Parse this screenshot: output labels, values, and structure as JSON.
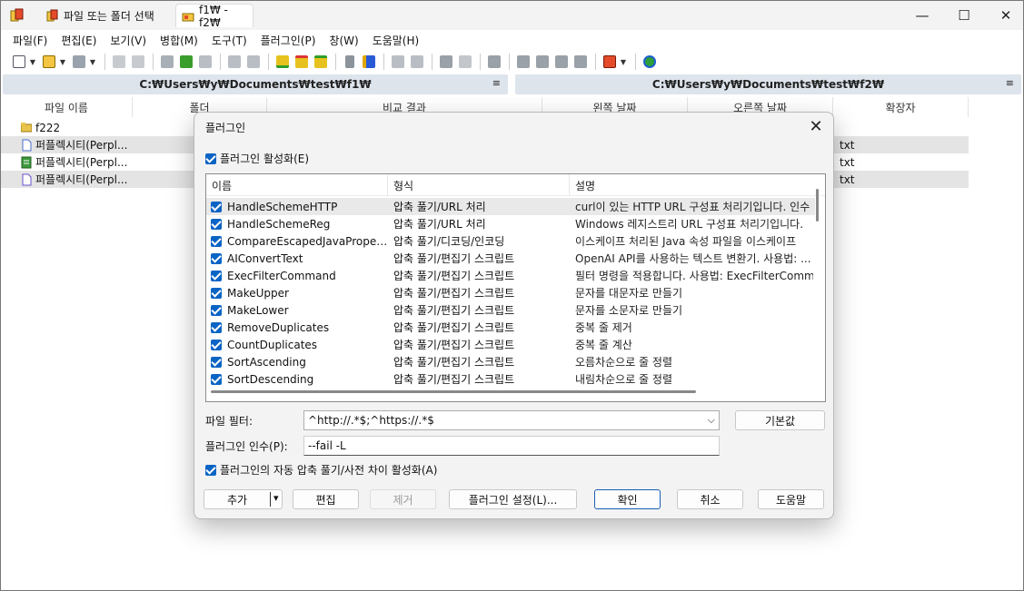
{
  "titlebar": {
    "tabs": [
      {
        "label": "파일 또는 폴더 선택"
      },
      {
        "label": "f1₩ - f2₩"
      }
    ],
    "controls": {
      "minimize": "—",
      "maximize": "☐",
      "close": "✕"
    }
  },
  "menu": [
    "파일(F)",
    "편집(E)",
    "보기(V)",
    "병합(M)",
    "도구(T)",
    "플러그인(P)",
    "창(W)",
    "도움말(H)"
  ],
  "paths": {
    "left": "C:₩Users₩y₩Documents₩test₩f1₩",
    "right": "C:₩Users₩y₩Documents₩test₩f2₩",
    "menu_glyph": "≡"
  },
  "columns": [
    "파일 이름",
    "폴더",
    "비교 결과",
    "왼쪽 날짜",
    "오른쪽 날짜",
    "확장자"
  ],
  "files": [
    {
      "name": "f222",
      "ext": "",
      "highlight": false,
      "icon": "folder-icon"
    },
    {
      "name": "퍼플렉시티(Perpl...",
      "ext": "txt",
      "highlight": true,
      "icon": "left-only-file-icon"
    },
    {
      "name": "퍼플렉시티(Perpl...",
      "ext": "txt",
      "highlight": false,
      "icon": "identical-file-icon"
    },
    {
      "name": "퍼플렉시티(Perpl...",
      "ext": "txt",
      "highlight": true,
      "icon": "right-only-file-icon"
    }
  ],
  "dialog": {
    "title": "플러그인",
    "close": "✕",
    "enable_label": "플러그인 활성화(E)",
    "list_headers": {
      "name": "이름",
      "type": "형식",
      "desc": "설명"
    },
    "plugins": [
      {
        "name": "HandleSchemeHTTP",
        "type": "압축 풀기/URL 처리",
        "desc": "curl이 있는 HTTP URL 구성표 처리기입니다. 인수",
        "selected": true
      },
      {
        "name": "HandleSchemeReg",
        "type": "압축 풀기/URL 처리",
        "desc": "Windows 레지스트리 URL 구성표 처리기입니다.",
        "selected": false
      },
      {
        "name": "CompareEscapedJavaProperties...",
        "type": "압축 풀기/디코딩/인코딩",
        "desc": "이스케이프 처리된 Java 속성 파일을 이스케이프",
        "selected": false
      },
      {
        "name": "AIConvertText",
        "type": "압축 풀기/편집기 스크립트",
        "desc": "OpenAI API를 사용하는 텍스트 변환기. 사용법: ...",
        "selected": false
      },
      {
        "name": "ExecFilterCommand",
        "type": "압축 풀기/편집기 스크립트",
        "desc": "필터 명령을 적용합니다. 사용법: ExecFilterComm",
        "selected": false
      },
      {
        "name": "MakeUpper",
        "type": "압축 풀기/편집기 스크립트",
        "desc": "문자를 대문자로 만들기",
        "selected": false
      },
      {
        "name": "MakeLower",
        "type": "압축 풀기/편집기 스크립트",
        "desc": "문자를 소문자로 만들기",
        "selected": false
      },
      {
        "name": "RemoveDuplicates",
        "type": "압축 풀기/편집기 스크립트",
        "desc": "중복 줄 제거",
        "selected": false
      },
      {
        "name": "CountDuplicates",
        "type": "압축 풀기/편집기 스크립트",
        "desc": "중복 줄 계산",
        "selected": false
      },
      {
        "name": "SortAscending",
        "type": "압축 풀기/편집기 스크립트",
        "desc": "오름차순으로 줄 정렬",
        "selected": false
      },
      {
        "name": "SortDescending",
        "type": "압축 풀기/편집기 스크립트",
        "desc": "내림차순으로 줄 정렬",
        "selected": false
      }
    ],
    "file_filter_label": "파일 필터:",
    "file_filter_value": "^http://.*$;^https://.*$",
    "default_button": "기본값",
    "args_label": "플러그인 인수(P):",
    "args_value": "--fail -L",
    "auto_label": "플러그인의 자동 압축 풀기/사전 차이 활성화(A)",
    "buttons": {
      "add": "추가",
      "add_dropdown": "▾",
      "edit": "편집",
      "remove": "제거",
      "settings": "플러그인 설정(L)...",
      "ok": "확인",
      "cancel": "취소",
      "help": "도움말"
    }
  },
  "colors": {
    "accent": "#0a64c4",
    "path_bar": "#dde4ec",
    "row_highlight": "#e4e4e4",
    "selected_row": "#e9e9e9"
  }
}
